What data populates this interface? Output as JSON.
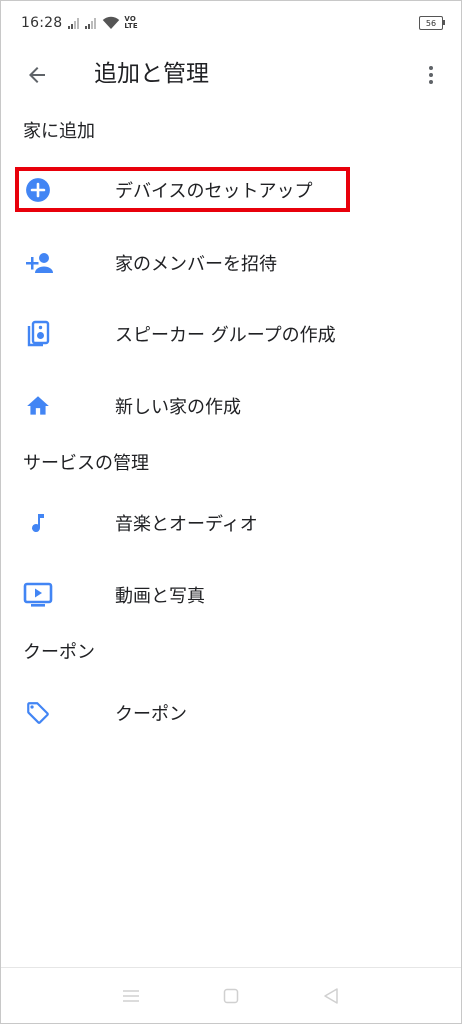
{
  "status_bar": {
    "time": "16:28",
    "volte_top": "VO",
    "volte_bottom": "LTE",
    "battery": "56"
  },
  "header": {
    "title": "追加と管理"
  },
  "sections": {
    "add_to_home": {
      "title": "家に追加",
      "items": [
        {
          "label": "デバイスのセットアップ",
          "icon": "add-circle-icon"
        },
        {
          "label": "家のメンバーを招待",
          "icon": "person-add-icon"
        },
        {
          "label": "スピーカー グループの作成",
          "icon": "speaker-group-icon"
        },
        {
          "label": "新しい家の作成",
          "icon": "home-icon"
        }
      ]
    },
    "manage_services": {
      "title": "サービスの管理",
      "items": [
        {
          "label": "音楽とオーディオ",
          "icon": "music-note-icon"
        },
        {
          "label": "動画と写真",
          "icon": "video-screen-icon"
        }
      ]
    },
    "coupons": {
      "title": "クーポン",
      "items": [
        {
          "label": "クーポン",
          "icon": "tag-icon"
        }
      ]
    }
  },
  "colors": {
    "accent": "#4285f4",
    "highlight": "#e8000b",
    "text": "#202124"
  }
}
